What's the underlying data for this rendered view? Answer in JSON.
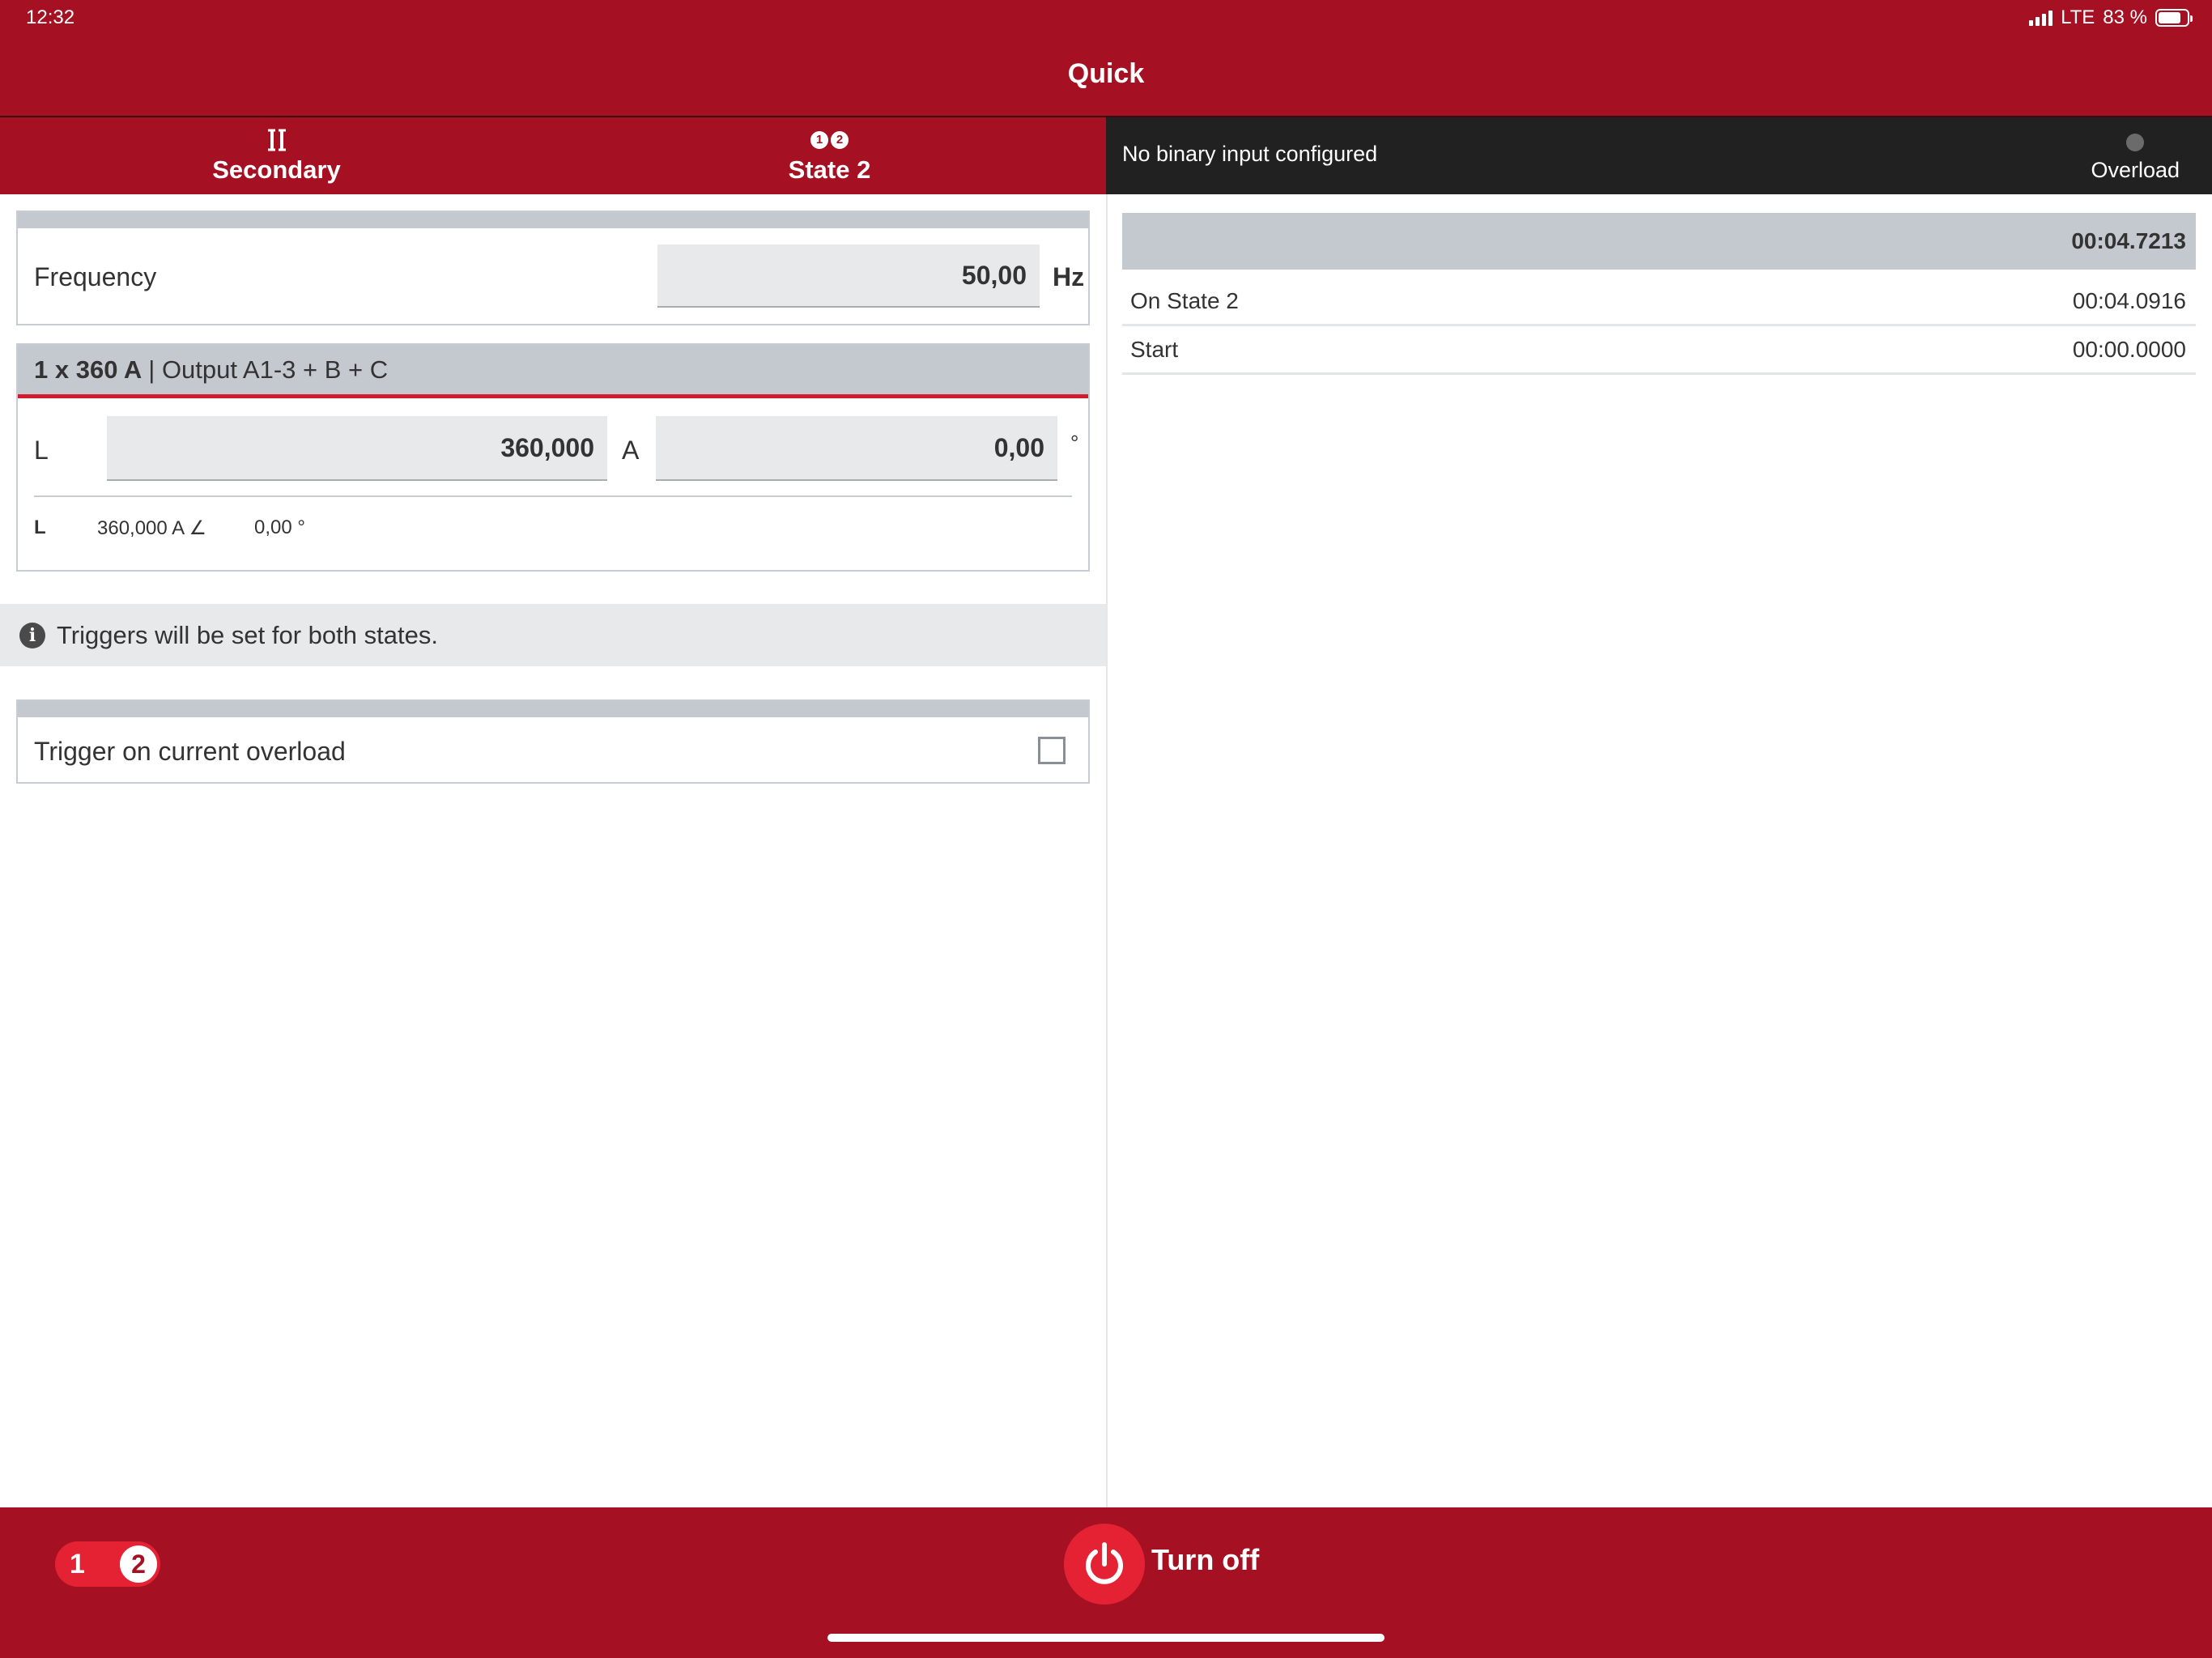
{
  "status_bar": {
    "time": "12:32",
    "network": "LTE",
    "battery": "83 %"
  },
  "app": {
    "title": "Quick"
  },
  "tabs": [
    {
      "label": "Secondary",
      "icon": "transformer-icon"
    },
    {
      "label": "State 2",
      "icon": "state-numbers-icon",
      "icon_digits": [
        "1",
        "2"
      ]
    }
  ],
  "info_bar": {
    "message": "No binary input configured",
    "overload_label": "Overload"
  },
  "frequency": {
    "label": "Frequency",
    "value": "50,00",
    "unit": "Hz"
  },
  "output": {
    "header_bold": "1 x 360 A",
    "header_rest": "| Output A1-3 + B + C",
    "row_label": "L",
    "amplitude": "360,000",
    "amplitude_unit": "A",
    "phase": "0,00",
    "phase_unit": "°",
    "summary_label": "L",
    "summary_amplitude": "360,000 A ∠",
    "summary_phase": "0,00 °"
  },
  "notice": {
    "text": "Triggers will be set for both states."
  },
  "trigger": {
    "label": "Trigger on current overload",
    "checked": false
  },
  "log": {
    "elapsed": "00:04.7213",
    "rows": [
      {
        "label": "On State 2",
        "time": "00:04.0916"
      },
      {
        "label": "Start",
        "time": "00:00.0000"
      }
    ]
  },
  "bottom": {
    "state_one": "1",
    "state_two": "2",
    "turn_off_label": "Turn off"
  },
  "colors": {
    "brand_red": "#a51122",
    "accent_red": "#e52233",
    "dark_bar": "#212121"
  }
}
